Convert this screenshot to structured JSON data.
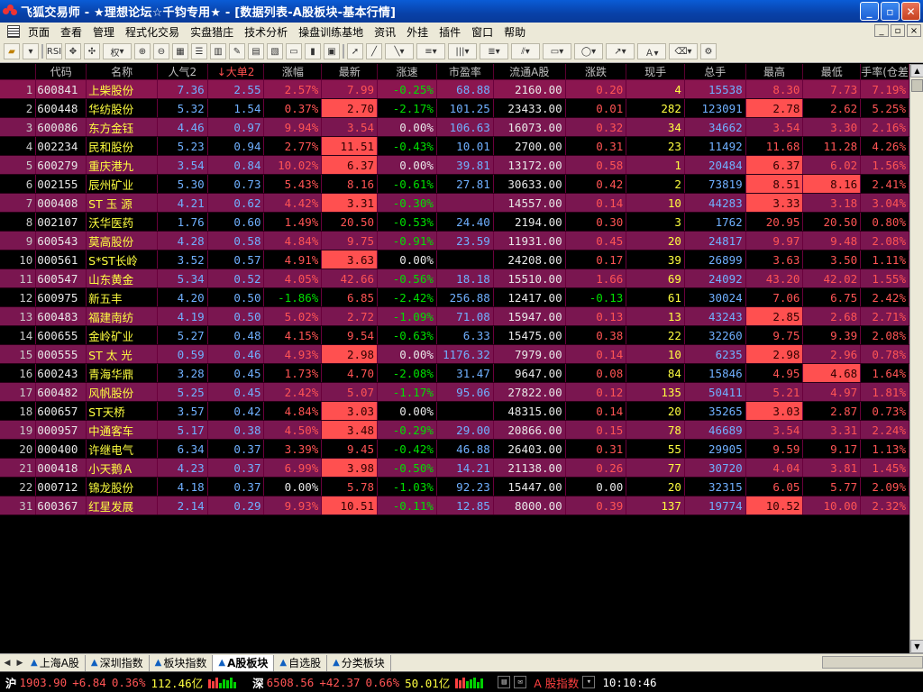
{
  "window": {
    "title": "飞狐交易师 - ★理想论坛☆千钧专用★ - [数据列表-A股板块-基本行情]"
  },
  "menu": [
    "页面",
    "查看",
    "管理",
    "程式化交易",
    "实盘猎庄",
    "技术分析",
    "操盘训练基地",
    "资讯",
    "外挂",
    "插件",
    "窗口",
    "帮助"
  ],
  "toolbar": {
    "combo_label": "权",
    "mdi_min": "_",
    "mdi_restore": "▫",
    "mdi_close": "×"
  },
  "columns": [
    "",
    "代码",
    "名称",
    "人气2",
    "↓大单2",
    "涨幅",
    "最新",
    "涨速",
    "市盈率",
    "流通A股",
    "涨跌",
    "现手",
    "总手",
    "最高",
    "最低",
    "手率(仓差"
  ],
  "rows": [
    [
      "1",
      "600841",
      "上柴股份",
      "7.36",
      "2.55",
      "2.57%",
      "7.99",
      "-0.25%",
      "68.88",
      "2160.00",
      "0.20",
      "4",
      "15538",
      "8.30",
      "7.73",
      "7.19%"
    ],
    [
      "2",
      "600448",
      "华纺股份",
      "5.32",
      "1.54",
      "0.37%",
      "2.70",
      "-2.17%",
      "101.25",
      "23433.00",
      "0.01",
      "282",
      "123091",
      "2.78",
      "2.62",
      "5.25%"
    ],
    [
      "3",
      "600086",
      "东方金钰",
      "4.46",
      "0.97",
      "9.94%",
      "3.54",
      "0.00%",
      "106.63",
      "16073.00",
      "0.32",
      "34",
      "34662",
      "3.54",
      "3.30",
      "2.16%"
    ],
    [
      "4",
      "002234",
      "民和股份",
      "5.23",
      "0.94",
      "2.77%",
      "11.51",
      "-0.43%",
      "10.01",
      "2700.00",
      "0.31",
      "23",
      "11492",
      "11.68",
      "11.28",
      "4.26%"
    ],
    [
      "5",
      "600279",
      "重庆港九",
      "3.54",
      "0.84",
      "10.02%",
      "6.37",
      "0.00%",
      "39.81",
      "13172.00",
      "0.58",
      "1",
      "20484",
      "6.37",
      "6.02",
      "1.56%"
    ],
    [
      "6",
      "002155",
      "辰州矿业",
      "5.30",
      "0.73",
      "5.43%",
      "8.16",
      "-0.61%",
      "27.81",
      "30633.00",
      "0.42",
      "2",
      "73819",
      "8.51",
      "8.16",
      "2.41%"
    ],
    [
      "7",
      "000408",
      "ST 玉 源",
      "4.21",
      "0.62",
      "4.42%",
      "3.31",
      "-0.30%",
      "",
      "14557.00",
      "0.14",
      "10",
      "44283",
      "3.33",
      "3.18",
      "3.04%"
    ],
    [
      "8",
      "002107",
      "沃华医药",
      "1.76",
      "0.60",
      "1.49%",
      "20.50",
      "-0.53%",
      "24.40",
      "2194.00",
      "0.30",
      "3",
      "1762",
      "20.95",
      "20.50",
      "0.80%"
    ],
    [
      "9",
      "600543",
      "莫高股份",
      "4.28",
      "0.58",
      "4.84%",
      "9.75",
      "-0.91%",
      "23.59",
      "11931.00",
      "0.45",
      "20",
      "24817",
      "9.97",
      "9.48",
      "2.08%"
    ],
    [
      "10",
      "000561",
      "S*ST长岭",
      "3.52",
      "0.57",
      "4.91%",
      "3.63",
      "0.00%",
      "",
      "24208.00",
      "0.17",
      "39",
      "26899",
      "3.63",
      "3.50",
      "1.11%"
    ],
    [
      "11",
      "600547",
      "山东黄金",
      "5.34",
      "0.52",
      "4.05%",
      "42.66",
      "-0.56%",
      "18.18",
      "15510.00",
      "1.66",
      "69",
      "24092",
      "43.20",
      "42.02",
      "1.55%"
    ],
    [
      "12",
      "600975",
      "新五丰",
      "4.20",
      "0.50",
      "-1.86%",
      "6.85",
      "-2.42%",
      "256.88",
      "12417.00",
      "-0.13",
      "61",
      "30024",
      "7.06",
      "6.75",
      "2.42%"
    ],
    [
      "13",
      "600483",
      "福建南纺",
      "4.19",
      "0.50",
      "5.02%",
      "2.72",
      "-1.09%",
      "71.08",
      "15947.00",
      "0.13",
      "13",
      "43243",
      "2.85",
      "2.68",
      "2.71%"
    ],
    [
      "14",
      "600655",
      "金岭矿业",
      "5.27",
      "0.48",
      "4.15%",
      "9.54",
      "-0.63%",
      "6.33",
      "15475.00",
      "0.38",
      "22",
      "32260",
      "9.75",
      "9.39",
      "2.08%"
    ],
    [
      "15",
      "000555",
      "ST 太 光",
      "0.59",
      "0.46",
      "4.93%",
      "2.98",
      "0.00%",
      "1176.32",
      "7979.00",
      "0.14",
      "10",
      "6235",
      "2.98",
      "2.96",
      "0.78%"
    ],
    [
      "16",
      "600243",
      "青海华鼎",
      "3.28",
      "0.45",
      "1.73%",
      "4.70",
      "-2.08%",
      "31.47",
      "9647.00",
      "0.08",
      "84",
      "15846",
      "4.95",
      "4.68",
      "1.64%"
    ],
    [
      "17",
      "600482",
      "风帆股份",
      "5.25",
      "0.45",
      "2.42%",
      "5.07",
      "-1.17%",
      "95.06",
      "27822.00",
      "0.12",
      "135",
      "50411",
      "5.21",
      "4.97",
      "1.81%"
    ],
    [
      "18",
      "600657",
      "ST天桥",
      "3.57",
      "0.42",
      "4.84%",
      "3.03",
      "0.00%",
      "",
      "48315.00",
      "0.14",
      "20",
      "35265",
      "3.03",
      "2.87",
      "0.73%"
    ],
    [
      "19",
      "000957",
      "中通客车",
      "5.17",
      "0.38",
      "4.50%",
      "3.48",
      "-0.29%",
      "29.00",
      "20866.00",
      "0.15",
      "78",
      "46689",
      "3.54",
      "3.31",
      "2.24%"
    ],
    [
      "20",
      "000400",
      "许继电气",
      "6.34",
      "0.37",
      "3.39%",
      "9.45",
      "-0.42%",
      "46.88",
      "26403.00",
      "0.31",
      "55",
      "29905",
      "9.59",
      "9.17",
      "1.13%"
    ],
    [
      "21",
      "000418",
      "小天鹅Ａ",
      "4.23",
      "0.37",
      "6.99%",
      "3.98",
      "-0.50%",
      "14.21",
      "21138.00",
      "0.26",
      "77",
      "30720",
      "4.04",
      "3.81",
      "1.45%"
    ],
    [
      "22",
      "000712",
      "锦龙股份",
      "4.18",
      "0.37",
      "0.00%",
      "5.78",
      "-1.03%",
      "92.23",
      "15447.00",
      "0.00",
      "20",
      "32315",
      "6.05",
      "5.77",
      "2.09%"
    ],
    [
      "31",
      "600367",
      "红星发展",
      "2.14",
      "0.29",
      "9.93%",
      "10.51",
      "-0.11%",
      "12.85",
      "8000.00",
      "0.39",
      "137",
      "19774",
      "10.52",
      "10.00",
      "2.32%"
    ]
  ],
  "tabs": [
    "上海A股",
    "深圳指数",
    "板块指数",
    "A股板块",
    "自选股",
    "分类板块"
  ],
  "active_tab": "A股板块",
  "status": {
    "sh_label": "沪",
    "sh_index": "1903.90",
    "sh_change": "+6.84",
    "sh_pct": "0.36%",
    "sh_amount": "112.46亿",
    "sz_label": "深",
    "sz_index": "6508.56",
    "sz_change": "+42.37",
    "sz_pct": "0.66%",
    "sz_amount": "50.01亿",
    "index_label": "A 股指数",
    "time": "10:10:46"
  },
  "colors": {
    "up": "#ff5454",
    "down": "#00e000",
    "code": "#ffff40",
    "row_odd": "#7a1650",
    "highlight": "#ff5050"
  }
}
